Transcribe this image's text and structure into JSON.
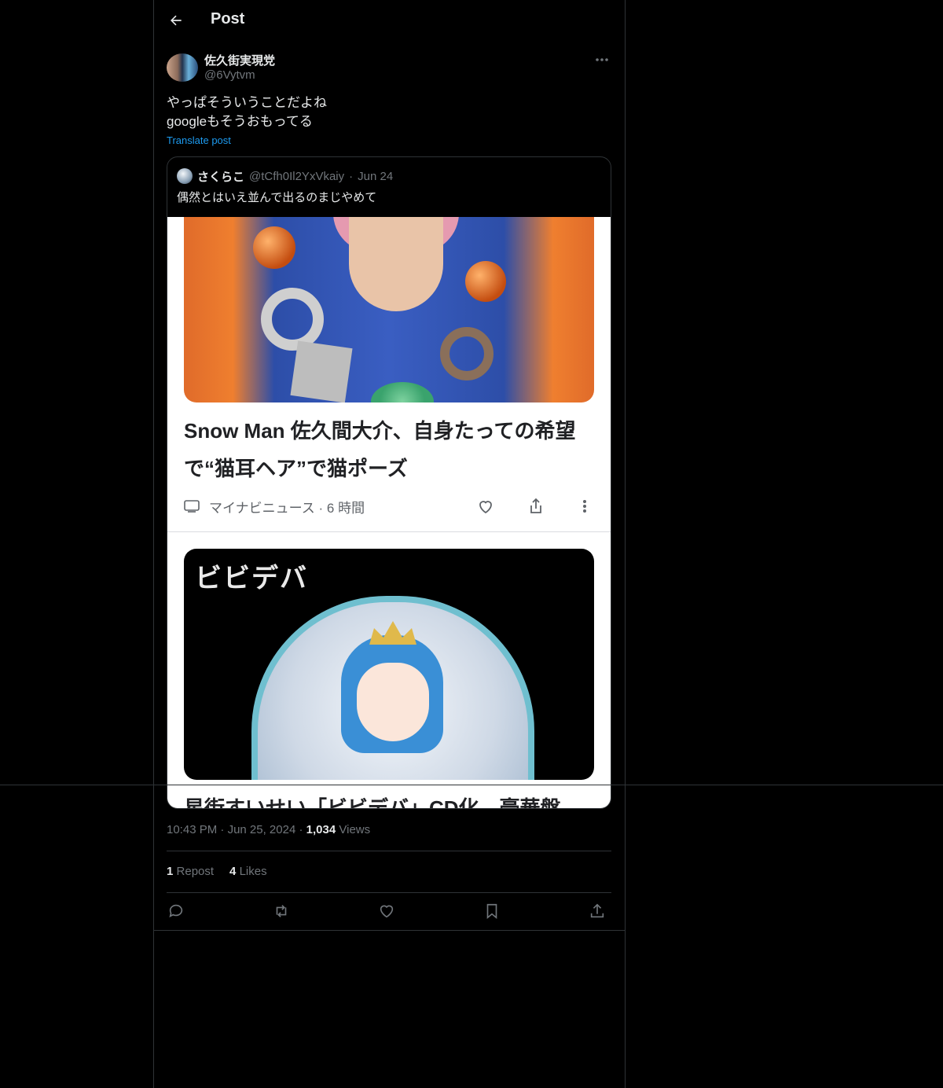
{
  "header": {
    "title": "Post",
    "back_icon": "arrow-left-icon"
  },
  "post": {
    "author": {
      "display_name": "佐久街実現党",
      "handle": "@6Vytvm"
    },
    "text": "やっぱそういうことだよね\ngoogleもそうおもってる",
    "translate_label": "Translate post",
    "timestamp": "10:43 PM",
    "date": "Jun 25, 2024",
    "views_count": "1,034",
    "views_label": "Views",
    "reposts_count": "1",
    "reposts_label": "Repost",
    "likes_count": "4",
    "likes_label": "Likes"
  },
  "quote": {
    "display_name": "さくらこ",
    "handle": "@tCfh0Il2YxVkaiy",
    "separator": "·",
    "date": "Jun 24",
    "text": "偶然とはいえ並んで出るのまじやめて",
    "media": {
      "headline1": "Snow Man 佐久間大介、自身たっての希望で“猫耳ヘア”で猫ポーズ",
      "source": "マイナビニュース · 6 時間",
      "logo_text": "ビビデバ",
      "headline2": "星街すいせい「ビビデバ」CD化　豪華盤"
    }
  },
  "meta_separator": "·",
  "colors": {
    "accent": "#1d9bf0",
    "muted": "#71767b",
    "text": "#e7e9ea",
    "border": "#2f3336"
  },
  "icons": [
    "arrow-left-icon",
    "more-horizontal-icon",
    "reply-icon",
    "repost-icon",
    "like-icon",
    "bookmark-icon",
    "share-icon"
  ]
}
